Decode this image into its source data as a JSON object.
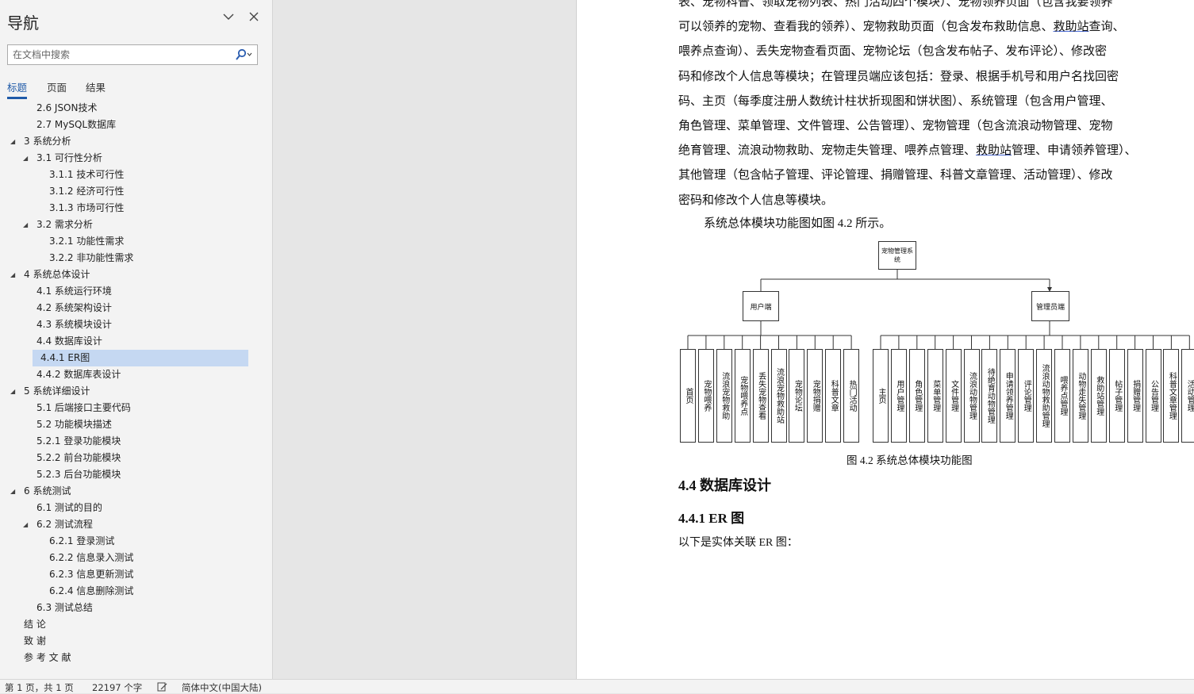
{
  "nav": {
    "title": "导航",
    "search_placeholder": "在文档中搜索",
    "tabs": [
      "标题",
      "页面",
      "结果"
    ],
    "items": [
      {
        "label": "2.6  JSON技术",
        "level": 2,
        "toggle": false,
        "selected": false
      },
      {
        "label": "2.7  MySQL数据库",
        "level": 2,
        "toggle": false,
        "selected": false
      },
      {
        "label": "3   系统分析",
        "level": 1,
        "toggle": true,
        "selected": false
      },
      {
        "label": "3.1  可行性分析",
        "level": 2,
        "toggle": true,
        "selected": false
      },
      {
        "label": "3.1.1  技术可行性",
        "level": 3,
        "toggle": false,
        "selected": false
      },
      {
        "label": "3.1.2  经济可行性",
        "level": 3,
        "toggle": false,
        "selected": false
      },
      {
        "label": "3.1.3  市场可行性",
        "level": 3,
        "toggle": false,
        "selected": false
      },
      {
        "label": "3.2  需求分析",
        "level": 2,
        "toggle": true,
        "selected": false
      },
      {
        "label": "3.2.1  功能性需求",
        "level": 3,
        "toggle": false,
        "selected": false
      },
      {
        "label": "3.2.2  非功能性需求",
        "level": 3,
        "toggle": false,
        "selected": false
      },
      {
        "label": "4   系统总体设计",
        "level": 1,
        "toggle": true,
        "selected": false
      },
      {
        "label": "4.1  系统运行环境",
        "level": 2,
        "toggle": false,
        "selected": false
      },
      {
        "label": "4.2  系统架构设计",
        "level": 2,
        "toggle": false,
        "selected": false
      },
      {
        "label": "4.3  系统模块设计",
        "level": 2,
        "toggle": false,
        "selected": false
      },
      {
        "label": "4.4  数据库设计",
        "level": 2,
        "toggle": false,
        "selected": false
      },
      {
        "label": "4.4.1 ER图",
        "level": 2,
        "toggle": false,
        "selected": true
      },
      {
        "label": "4.4.2 数据库表设计",
        "level": 2,
        "toggle": false,
        "selected": false
      },
      {
        "label": "5   系统详细设计",
        "level": 1,
        "toggle": true,
        "selected": false
      },
      {
        "label": "5.1 后端接口主要代码",
        "level": 2,
        "toggle": false,
        "selected": false
      },
      {
        "label": "5.2 功能模块描述",
        "level": 2,
        "toggle": false,
        "selected": false
      },
      {
        "label": "5.2.1  登录功能模块",
        "level": 2,
        "toggle": false,
        "selected": false
      },
      {
        "label": "5.2.2  前台功能模块",
        "level": 2,
        "toggle": false,
        "selected": false
      },
      {
        "label": "5.2.3  后台功能模块",
        "level": 2,
        "toggle": false,
        "selected": false
      },
      {
        "label": "6   系统测试",
        "level": 1,
        "toggle": true,
        "selected": false
      },
      {
        "label": "6.1  测试的目的",
        "level": 2,
        "toggle": false,
        "selected": false
      },
      {
        "label": "6.2  测试流程",
        "level": 2,
        "toggle": true,
        "selected": false
      },
      {
        "label": "6.2.1  登录测试",
        "level": 3,
        "toggle": false,
        "selected": false
      },
      {
        "label": "6.2.2  信息录入测试",
        "level": 3,
        "toggle": false,
        "selected": false
      },
      {
        "label": "6.2.3  信息更新测试",
        "level": 3,
        "toggle": false,
        "selected": false
      },
      {
        "label": "6.2.4  信息删除测试",
        "level": 3,
        "toggle": false,
        "selected": false
      },
      {
        "label": "6.3  测试总结",
        "level": 2,
        "toggle": false,
        "selected": false
      },
      {
        "label": "结  论",
        "level": 1,
        "toggle": false,
        "selected": false
      },
      {
        "label": "致  谢",
        "level": 1,
        "toggle": false,
        "selected": false
      },
      {
        "label": "参 考 文 献",
        "level": 1,
        "toggle": false,
        "selected": false
      }
    ]
  },
  "document": {
    "paragraph_lines": [
      [
        {
          "t": "表、宠物科普、领取宠物列表、热门活动四个模块）、宠物领养页面（包含我要领养"
        }
      ],
      [
        {
          "t": "可以领养的宠物、查看我的领养）、宠物救助页面（包含发布救助信息、"
        },
        {
          "t": "救助站",
          "u": true
        },
        {
          "t": "查询、"
        }
      ],
      [
        {
          "t": "喂养点查询）、丢失宠物查看页面、宠物论坛（包含发布帖子、发布评论）、修改密"
        }
      ],
      [
        {
          "t": "码和修改个人信息等模块；在管理员端应该包括：登录、根据手机号和用户名找回密"
        }
      ],
      [
        {
          "t": "码、主页（每季度注册人数统计柱状折现图和饼状图）、系统管理（包含用户管理、"
        }
      ],
      [
        {
          "t": "角色管理、菜单管理、文件管理、公告管理）、宠物管理（包含流浪动物管理、宠物"
        }
      ],
      [
        {
          "t": "绝育管理、流浪动物救助、宠物走失管理、喂养点管理、"
        },
        {
          "t": "救助站",
          "u": true
        },
        {
          "t": "管理、申请领养管理）、"
        }
      ],
      [
        {
          "t": "其他管理（包含帖子管理、评论管理、捐赠管理、科普文章管理、活动管理）、修改"
        }
      ],
      [
        {
          "t": "密码和修改个人信息等模块。"
        }
      ]
    ],
    "intro_sentence": "系统总体模块功能图如图 4.2 所示。",
    "diagram": {
      "root": "宠物管理系统",
      "user_branch": "用户端",
      "admin_branch": "管理员端",
      "user_modules": [
        "首页",
        "宠物喂养",
        "流浪宠物救助",
        "宠物喂养点",
        "丢失宠物查看",
        "流浪宠物救助站",
        "宠物论坛",
        "宠物捐赠",
        "科普文章",
        "热门活动"
      ],
      "admin_modules": [
        "主页",
        "用户管理",
        "角色管理",
        "菜单管理",
        "文件管理",
        "流浪动物管理",
        "待绝育动物管理",
        "申请领养管理",
        "评论管理",
        "流浪动物救助管理",
        "喂养点管理",
        "动物走失管理",
        "救助站管理",
        "帖子管理",
        "捐赠管理",
        "公告管理",
        "科普文章管理",
        "活动管理"
      ]
    },
    "figure_caption": "图 4.2  系统总体模块功能图",
    "heading_44": "4.4    数据库设计",
    "heading_441": "4.4.1 ER 图",
    "er_intro": "以下是实体关联 ER 图："
  },
  "status": {
    "page": "第 1 页，共 1 页",
    "words": "22197 个字",
    "language": "简体中文(中国大陆)"
  }
}
